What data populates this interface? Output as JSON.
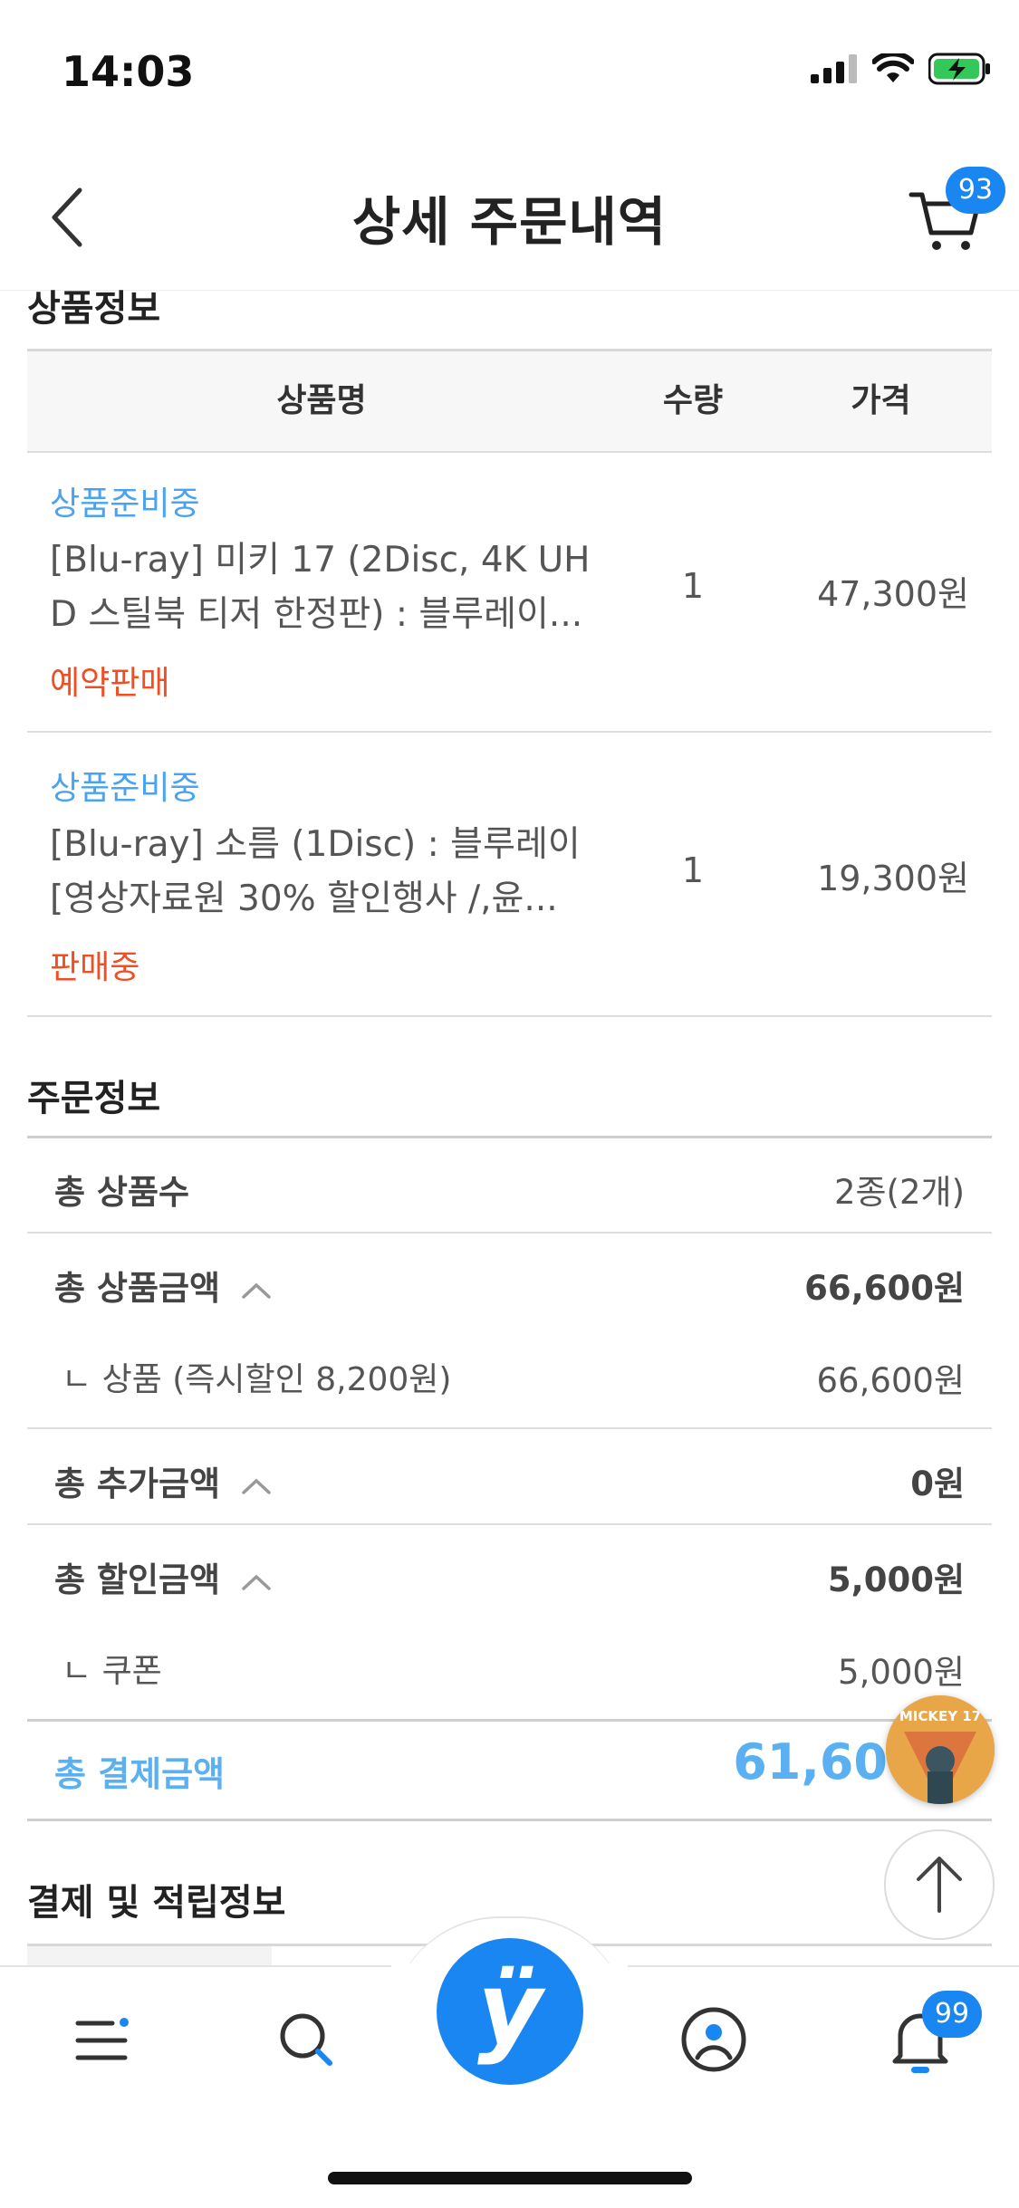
{
  "status_bar": {
    "time": "14:03"
  },
  "header": {
    "title": "상세 주문내역",
    "cart_count": "93"
  },
  "products": {
    "section_title": "상품정보",
    "columns": {
      "name": "상품명",
      "qty": "수량",
      "price": "가격"
    },
    "items": [
      {
        "status": "상품준비중",
        "name_line1": "[Blu-ray] 미키 17 (2Disc, 4K UH",
        "name_line2": "D 스틸북 티저 한정판) : 블루레이...",
        "sale_status": "예약판매",
        "qty": "1",
        "price": "47,300원"
      },
      {
        "status": "상품준비중",
        "name_line1": "[Blu-ray] 소름 (1Disc) : 블루레이",
        "name_line2": "[영상자료원 30% 할인행사 /,윤...",
        "sale_status": "판매중",
        "qty": "1",
        "price": "19,300원"
      }
    ]
  },
  "order_info": {
    "section_title": "주문정보",
    "total_items_label": "총 상품수",
    "total_items_value": "2종(2개)",
    "total_product_amount_label": "총 상품금액",
    "total_product_amount_value": "66,600원",
    "product_sub_label": "ㄴ 상품 (즉시할인 8,200원)",
    "product_sub_value": "66,600원",
    "total_extra_label": "총 추가금액",
    "total_extra_value": "0원",
    "total_discount_label": "총 할인금액",
    "total_discount_value": "5,000원",
    "coupon_label": "ㄴ 쿠폰",
    "coupon_value": "5,000원",
    "total_payment_label": "총 결제금액",
    "total_payment_value": "61,60"
  },
  "payment_section": {
    "title": "결제 및 적립정보"
  },
  "floating": {
    "thumbnail_text": "MICKEY 17"
  },
  "bottom_nav": {
    "notification_count": "99",
    "center_logo": "ÿ"
  },
  "colors": {
    "accent": "#1a86f2",
    "status_blue": "#4aa3f0",
    "sale_red": "#f04e23"
  }
}
